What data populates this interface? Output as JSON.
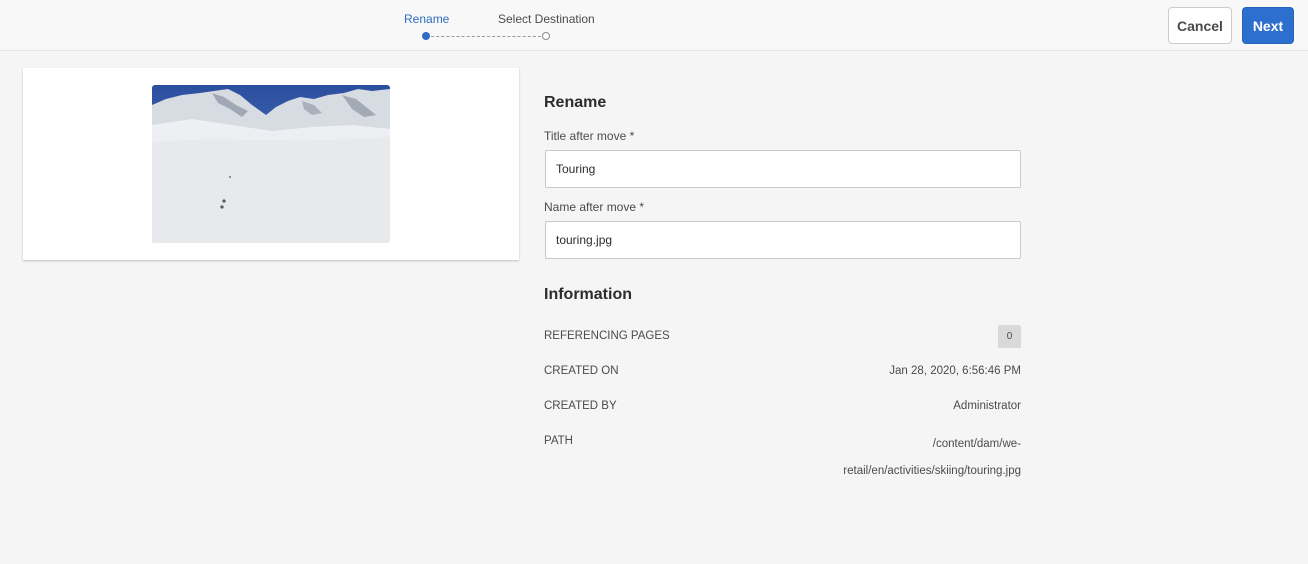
{
  "wizard": {
    "steps": [
      {
        "label": "Rename",
        "state": "active"
      },
      {
        "label": "Select Destination",
        "state": "inactive"
      }
    ]
  },
  "actions": {
    "cancel_label": "Cancel",
    "next_label": "Next"
  },
  "preview": {
    "image_icon": "snowy-mountain-image"
  },
  "rename": {
    "heading": "Rename",
    "title_label": "Title after move *",
    "title_value": "Touring",
    "name_label": "Name after move *",
    "name_value": "touring.jpg"
  },
  "information": {
    "heading": "Information",
    "referencing_pages_label": "REFERENCING PAGES",
    "referencing_pages_count": "0",
    "created_on_label": "CREATED ON",
    "created_on_value": "Jan 28, 2020, 6:56:46 PM",
    "created_by_label": "CREATED BY",
    "created_by_value": "Administrator",
    "path_label": "PATH",
    "path_line1": "/content/dam/we-",
    "path_line2": "retail/en/activities/skiing/touring.jpg"
  },
  "colors": {
    "accent": "#2c6fcf",
    "active_step": "#2d6cc1",
    "background": "#f5f5f5"
  }
}
